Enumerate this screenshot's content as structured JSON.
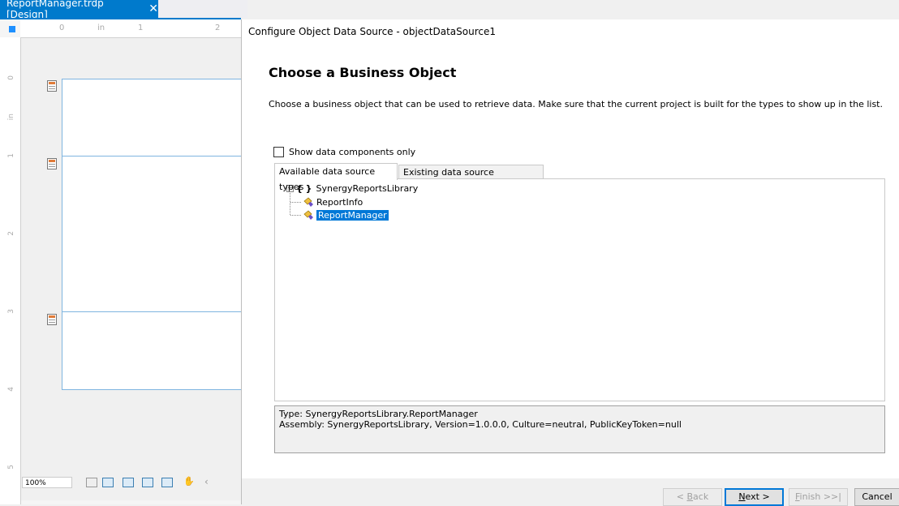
{
  "document_tab": {
    "title": "ReportManager.trdp [Design]",
    "close_glyph": "✕"
  },
  "designer": {
    "ruler_top": [
      "0",
      "in",
      "1",
      "2"
    ],
    "ruler_left": [
      "0",
      "in",
      "1",
      "2",
      "3",
      "4",
      "5"
    ],
    "zoom": "100%"
  },
  "dialog": {
    "title": "Configure Object Data Source - objectDataSource1",
    "heading": "Choose a Business Object",
    "description": "Choose a business object that can be used to retrieve data. Make sure that the current project is built for the types to show up in the list.",
    "show_data_components_only": "Show data components only",
    "tabs": [
      {
        "label": "Available data source types"
      },
      {
        "label": "Existing data source components"
      }
    ],
    "tree": {
      "root": {
        "expander": "−",
        "icon": "{ }",
        "label": "SynergyReportsLibrary"
      },
      "children": [
        {
          "label": "ReportInfo"
        },
        {
          "label": "ReportManager"
        }
      ]
    },
    "info": {
      "type_line": "Type: SynergyReportsLibrary.ReportManager",
      "assembly_line": "Assembly: SynergyReportsLibrary, Version=1.0.0.0, Culture=neutral, PublicKeyToken=null"
    },
    "buttons": {
      "back_prefix": "< ",
      "back_key": "B",
      "back_rest": "ack",
      "next_key": "N",
      "next_rest": "ext >",
      "finish_key": "F",
      "finish_rest": "inish >>|",
      "cancel": "Cancel"
    }
  },
  "colors": {
    "accent": "#007acc",
    "selection": "#0078d7"
  }
}
